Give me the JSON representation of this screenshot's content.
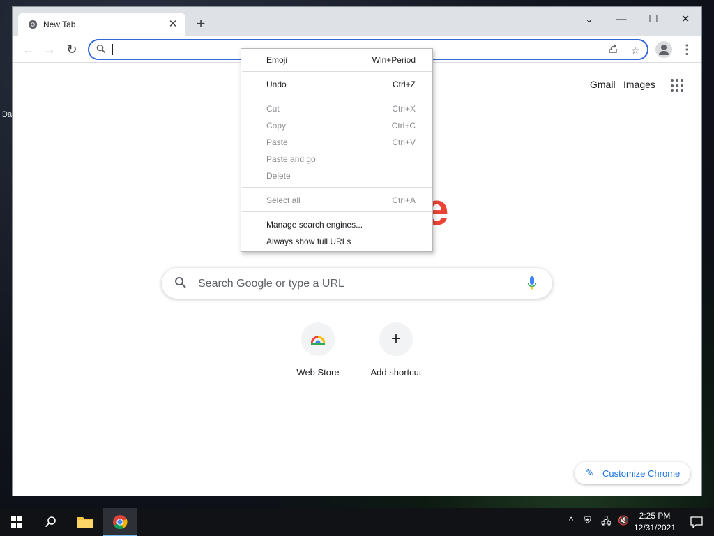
{
  "desktop": {
    "icon_label_fragment": "Da"
  },
  "browser": {
    "tab": {
      "title": "New Tab"
    },
    "window_controls": {
      "tab_search": "⌄",
      "minimize": "—",
      "maximize": "☐",
      "close": "✕"
    },
    "omnibox": {
      "value": ""
    }
  },
  "ntp": {
    "top_links": {
      "gmail": "Gmail",
      "images": "Images"
    },
    "logo_fragment": "e",
    "search_placeholder": "Search Google or type a URL",
    "shortcuts": [
      {
        "label": "Web Store",
        "icon": "chrome-web-store-icon"
      },
      {
        "label": "Add shortcut",
        "icon": "plus-icon",
        "glyph": "+"
      }
    ],
    "customize_label": "Customize Chrome"
  },
  "context_menu": {
    "items": [
      {
        "label": "Emoji",
        "shortcut": "Win+Period",
        "enabled": true
      },
      {
        "label": "Undo",
        "shortcut": "Ctrl+Z",
        "enabled": true
      },
      {
        "label": "Cut",
        "shortcut": "Ctrl+X",
        "enabled": false
      },
      {
        "label": "Copy",
        "shortcut": "Ctrl+C",
        "enabled": false
      },
      {
        "label": "Paste",
        "shortcut": "Ctrl+V",
        "enabled": false
      },
      {
        "label": "Paste and go",
        "shortcut": "",
        "enabled": false
      },
      {
        "label": "Delete",
        "shortcut": "",
        "enabled": false
      },
      {
        "label": "Select all",
        "shortcut": "Ctrl+A",
        "enabled": false
      },
      {
        "label": "Manage search engines...",
        "shortcut": "",
        "enabled": true
      },
      {
        "label": "Always show full URLs",
        "shortcut": "",
        "enabled": true
      }
    ]
  },
  "taskbar": {
    "clock_time": "2:25 PM",
    "clock_date": "12/31/2021"
  }
}
